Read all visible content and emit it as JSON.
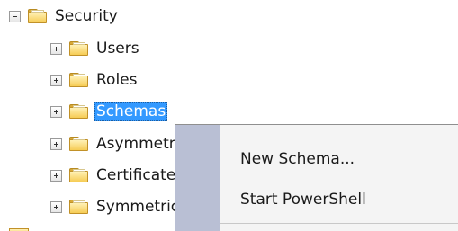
{
  "tree": {
    "root": {
      "label": "Security",
      "expander": "minus",
      "icon": "folder-icon"
    },
    "children": [
      {
        "label": "Users",
        "expander": "plus",
        "icon": "folder-icon"
      },
      {
        "label": "Roles",
        "expander": "plus",
        "icon": "folder-icon"
      },
      {
        "label": "Schemas",
        "expander": "plus",
        "icon": "folder-icon",
        "selected": true
      },
      {
        "label": "Asymmetric Keys",
        "expander": "plus",
        "icon": "folder-icon"
      },
      {
        "label": "Certificates",
        "expander": "plus",
        "icon": "folder-icon"
      },
      {
        "label": "Symmetric Keys",
        "expander": "plus",
        "icon": "folder-icon"
      }
    ]
  },
  "context_menu": {
    "items": [
      {
        "label": "New Schema..."
      },
      {
        "label": "Start PowerShell"
      }
    ],
    "gutter_color": "#b9bfd4",
    "background_color": "#f4f4f4"
  },
  "colors": {
    "selection": "#3399ff",
    "folder": "#f6cc55"
  }
}
